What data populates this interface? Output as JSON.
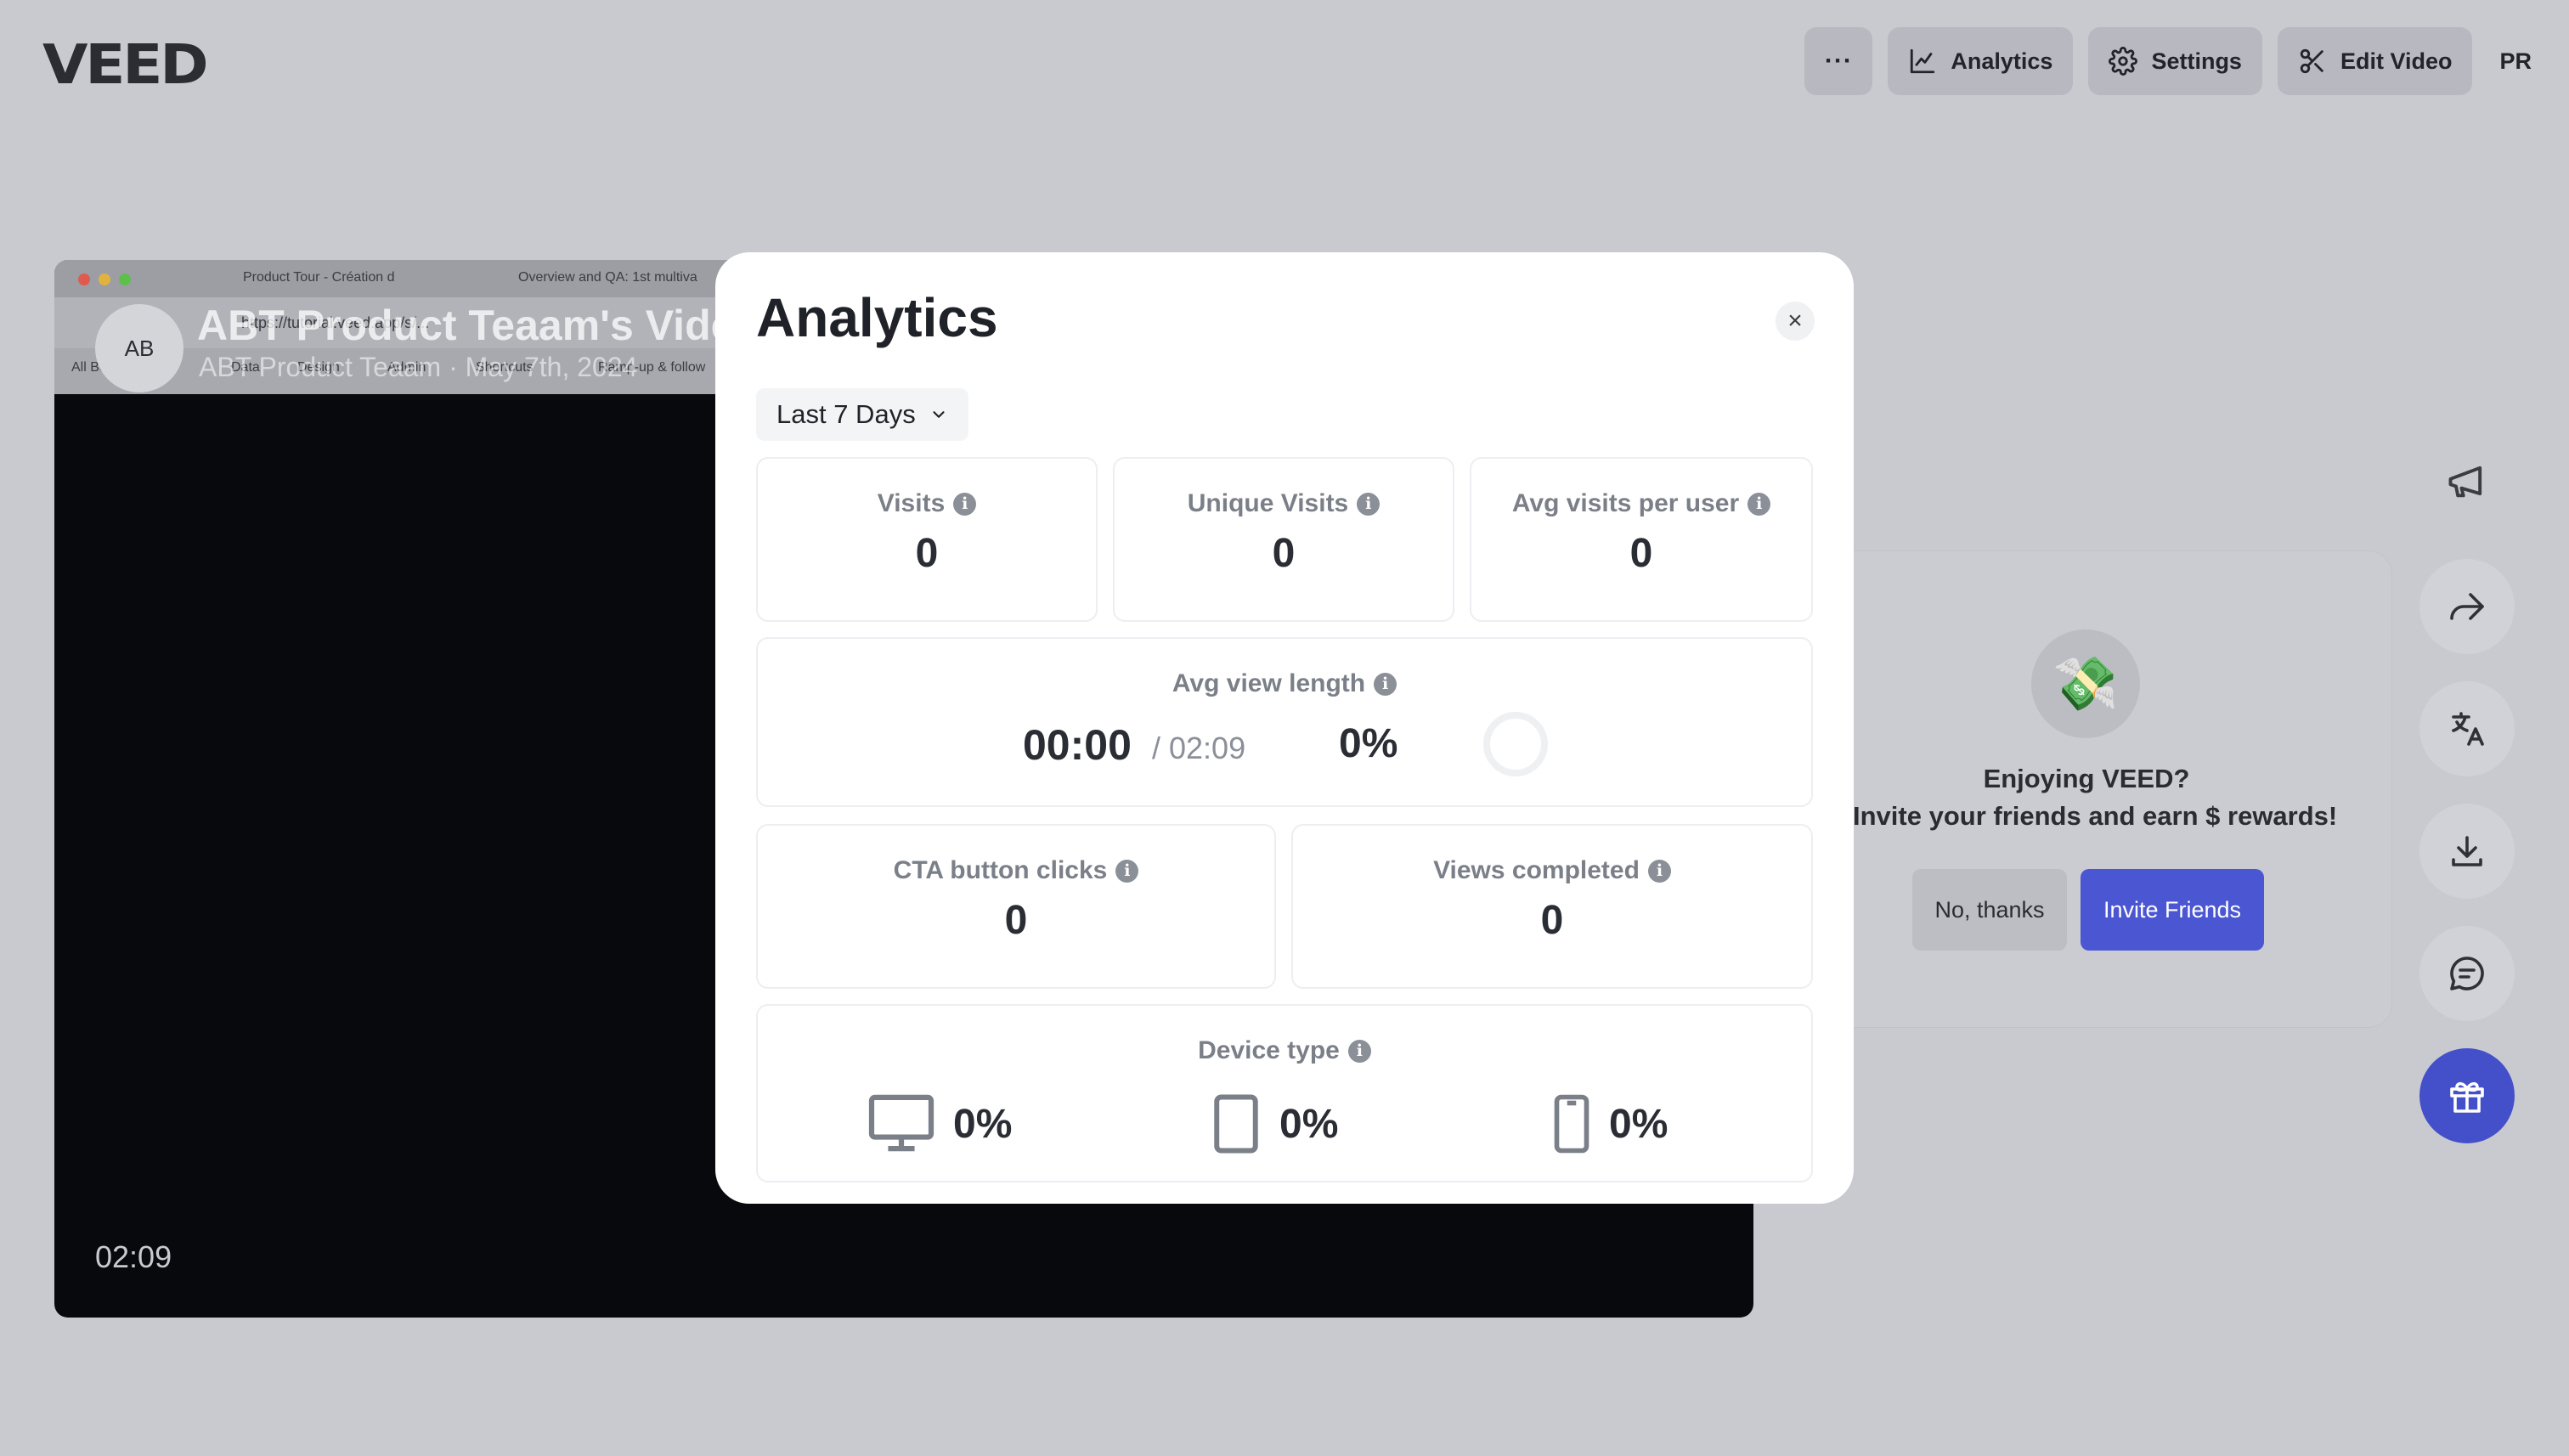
{
  "app": {
    "logo": "VEED",
    "user_initials": "PR"
  },
  "topnav": {
    "more_label": "···",
    "analytics_label": "Analytics",
    "settings_label": "Settings",
    "edit_label": "Edit Video"
  },
  "video": {
    "browser_tabs": [
      "Product Tour - Création d",
      "Overview and QA: 1st multiva"
    ],
    "url": "https://tutorial.veed.app/s/...",
    "bookmarks": [
      "All Bookmarks",
      "Data",
      "Design",
      "Admin",
      "Shortcuts",
      "Ramp-up & follow"
    ],
    "avatar": "AB",
    "title": "ABT Product Teaam's Video",
    "subtitle": "ABT Product Teaam · May 7th, 2024",
    "duration": "02:09"
  },
  "referral": {
    "icon": "💸",
    "title": "Enjoying VEED?",
    "description": "Invite your friends and earn $ rewards!",
    "decline_label": "No, thanks",
    "invite_label": "Invite Friends"
  },
  "analytics": {
    "title": "Analytics",
    "close_glyph": "×",
    "range": "Last 7 Days",
    "visits": {
      "label": "Visits",
      "value": "0"
    },
    "unique_visits": {
      "label": "Unique Visits",
      "value": "0"
    },
    "avg_visits": {
      "label": "Avg visits per user",
      "value": "0"
    },
    "avg_view_length": {
      "label": "Avg view length",
      "time": "00:00",
      "total": "/ 02:09",
      "percent": "0%"
    },
    "cta_clicks": {
      "label": "CTA button clicks",
      "value": "0"
    },
    "views_completed": {
      "label": "Views completed",
      "value": "0"
    },
    "device_type": {
      "label": "Device type",
      "desktop": "0%",
      "tablet": "0%",
      "mobile": "0%"
    }
  },
  "colors": {
    "accent": "#4a56d2",
    "backdrop": "#c9cad0",
    "modal": "#ffffff"
  }
}
